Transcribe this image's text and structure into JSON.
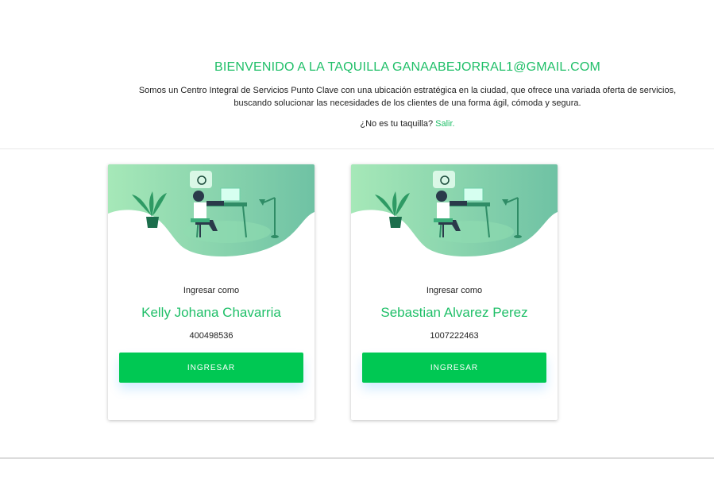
{
  "header": {
    "title": "BIENVENIDO A LA TAQUILLA GANAABEJORRAL1@GMAIL.COM",
    "description_line1": "Somos un Centro Integral de Servicios Punto Clave con una ubicación estratégica en la ciudad, que ofrece una variada oferta de servicios,",
    "description_line2": "buscando solucionar las necesidades de los clientes de una forma ágil, cómoda y segura.",
    "not_your_booth": "¿No es tu taquilla?",
    "logout_link": "Salir."
  },
  "colors": {
    "accent": "#1fbf68",
    "button": "#00c853"
  },
  "cards": [
    {
      "illustration_icon": "desk-worker-illustration",
      "subtitle": "Ingresar como",
      "name": "Kelly Johana Chavarria",
      "id_number": "400498536",
      "button_label": "INGRESAR"
    },
    {
      "illustration_icon": "desk-worker-illustration",
      "subtitle": "Ingresar como",
      "name": "Sebastian Alvarez Perez",
      "id_number": "1007222463",
      "button_label": "INGRESAR"
    }
  ]
}
